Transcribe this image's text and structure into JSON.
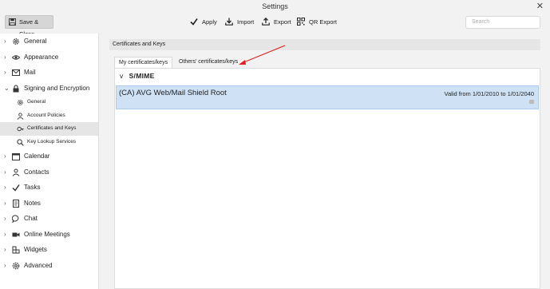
{
  "window": {
    "title": "Settings"
  },
  "toolbar": {
    "save_close": "Save & Close",
    "apply": "Apply",
    "import": "Import",
    "export": "Export",
    "qr_export": "QR Export",
    "search_placeholder": "Search"
  },
  "sidebar": {
    "items": [
      {
        "label": "General",
        "icon": "gear-icon",
        "expanded": false
      },
      {
        "label": "Appearance",
        "icon": "eye-icon",
        "expanded": false
      },
      {
        "label": "Mail",
        "icon": "envelope-icon",
        "expanded": false
      },
      {
        "label": "Signing and Encryption",
        "icon": "lock-icon",
        "expanded": true,
        "children": [
          {
            "label": "General",
            "icon": "gear-small-icon"
          },
          {
            "label": "Account Policies",
            "icon": "user-small-icon"
          },
          {
            "label": "Certificates and Keys",
            "icon": "certificate-icon",
            "active": true
          },
          {
            "label": "Key Lookup Services",
            "icon": "search-small-icon"
          }
        ]
      },
      {
        "label": "Calendar",
        "icon": "calendar-icon",
        "expanded": false
      },
      {
        "label": "Contacts",
        "icon": "person-icon",
        "expanded": false
      },
      {
        "label": "Tasks",
        "icon": "check-icon",
        "expanded": false
      },
      {
        "label": "Notes",
        "icon": "note-icon",
        "expanded": false
      },
      {
        "label": "Chat",
        "icon": "chat-icon",
        "expanded": false
      },
      {
        "label": "Online Meetings",
        "icon": "video-icon",
        "expanded": false
      },
      {
        "label": "Widgets",
        "icon": "widgets-icon",
        "expanded": false
      },
      {
        "label": "Advanced",
        "icon": "advanced-gear-icon",
        "expanded": false
      }
    ]
  },
  "main": {
    "section_title": "Certificates and Keys",
    "tabs": [
      {
        "label": "My certificates/keys",
        "active": true
      },
      {
        "label": "Others' certificates/keys",
        "active": false
      }
    ],
    "group": {
      "label": "S/MIME",
      "collapse_glyph": "v"
    },
    "certificates": [
      {
        "name": "(CA) AVG Web/Mail Shield Root",
        "validity": "Valid from 1/01/2010 to 1/01/2040",
        "selected": true
      }
    ]
  },
  "colors": {
    "selected_row": "#cfe2f5",
    "annotation_arrow": "#e02020"
  }
}
